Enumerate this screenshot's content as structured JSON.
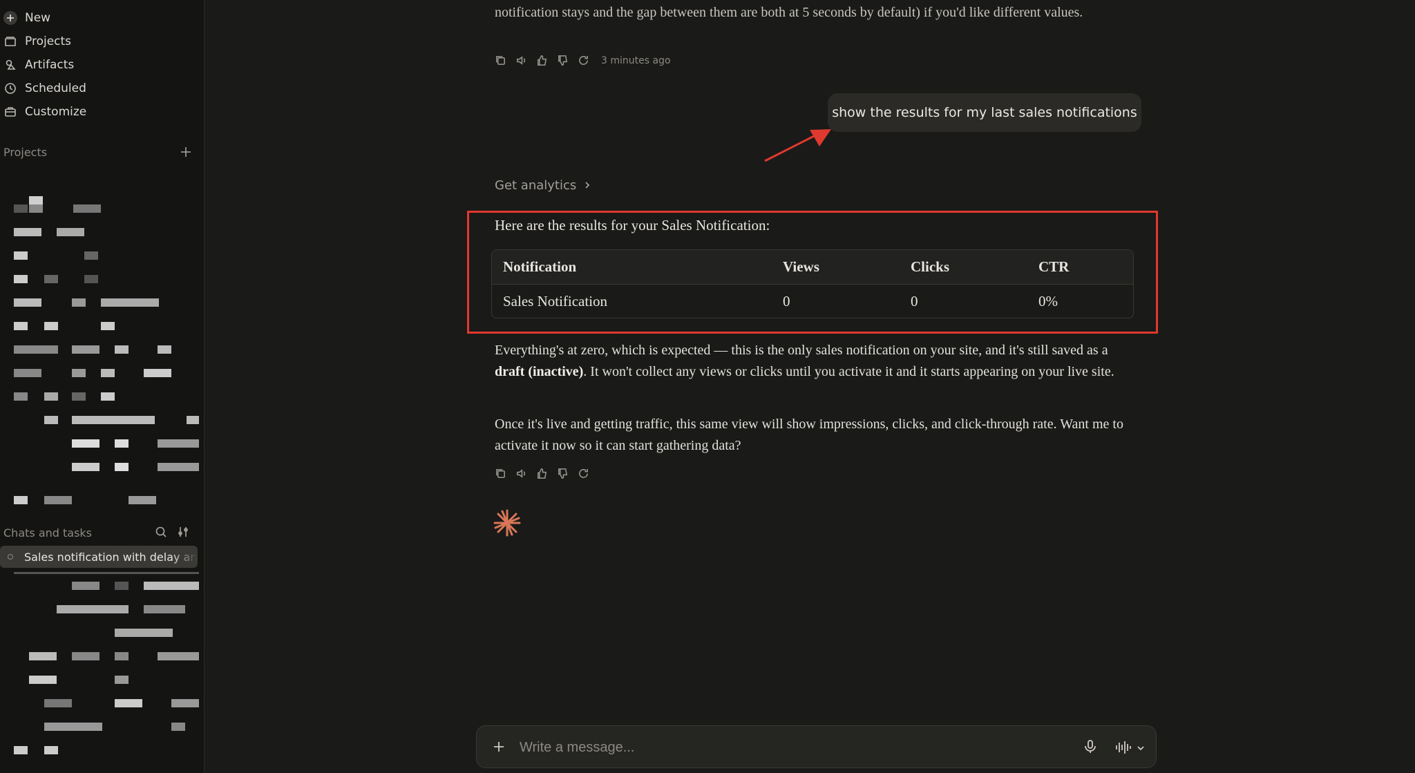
{
  "sidebar": {
    "nav": [
      {
        "label": "New",
        "icon": "plus-icon"
      },
      {
        "label": "Projects",
        "icon": "folder-icon"
      },
      {
        "label": "Artifacts",
        "icon": "shapes-icon"
      },
      {
        "label": "Scheduled",
        "icon": "clock-icon"
      },
      {
        "label": "Customize",
        "icon": "briefcase-icon"
      }
    ],
    "projects_label": "Projects",
    "chats_label": "Chats and tasks",
    "active_chat": "Sales notification with delay and"
  },
  "conversation": {
    "prev_text": "notification stays and the gap between them are both at 5 seconds by default) if you'd like different values.",
    "prev_timestamp": "3 minutes ago",
    "user_message": "show the results for my last sales notifications",
    "tool_label": "Get analytics",
    "result_intro": "Here are the results for your Sales Notification:",
    "table": {
      "headers": [
        "Notification",
        "Views",
        "Clicks",
        "CTR"
      ],
      "rows": [
        [
          "Sales Notification",
          "0",
          "0",
          "0%"
        ]
      ]
    },
    "para1_a": "Everything's at zero, which is expected — this is the only sales notification on your site, and it's still saved as a ",
    "para1_b": "draft (inactive)",
    "para1_c": ". It won't collect any views or clicks until you activate it and it starts appearing on your live site.",
    "para2": "Once it's live and getting traffic, this same view will show impressions, clicks, and click-through rate. Want me to activate it now so it can start gathering data?"
  },
  "composer": {
    "placeholder": "Write a message..."
  },
  "colors": {
    "highlight": "#e0392f",
    "spark": "#d97757",
    "background": "#1a1a18"
  }
}
